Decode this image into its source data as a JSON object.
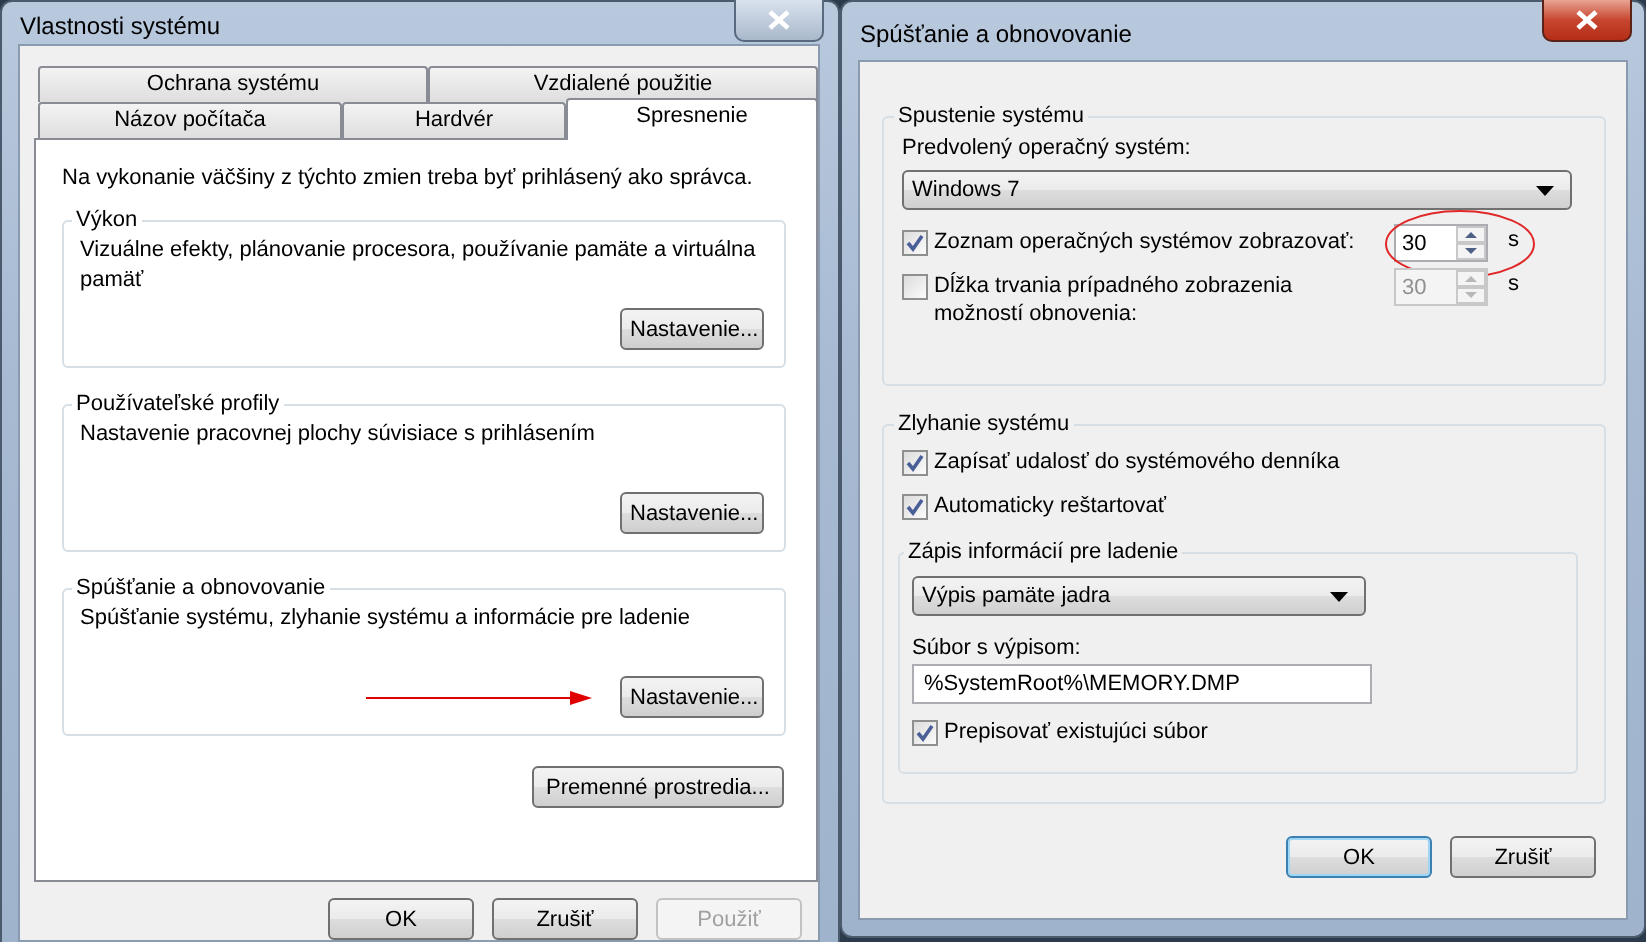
{
  "system_properties": {
    "title": "Vlastnosti systému",
    "tab_rows": [
      [
        {
          "label": "Ochrana systému",
          "selected": false
        },
        {
          "label": "Vzdialené použitie",
          "selected": false
        }
      ],
      [
        {
          "label": "Názov počítača",
          "selected": false
        },
        {
          "label": "Hardvér",
          "selected": false
        },
        {
          "label": "Spresnenie",
          "selected": true
        }
      ]
    ],
    "notice": "Na vykonanie väčšiny z týchto zmien treba byť prihlásený ako správca.",
    "groups": [
      {
        "title": "Výkon",
        "description": "Vizuálne efekty, plánovanie procesora, používanie pamäte a virtuálna pamäť",
        "button": "Nastavenie...",
        "arrow": false
      },
      {
        "title": "Používateľské profily",
        "description": "Nastavenie pracovnej plochy súvisiace s prihlásením",
        "button": "Nastavenie...",
        "arrow": false
      },
      {
        "title": "Spúšťanie a obnovovanie",
        "description": "Spúšťanie systému, zlyhanie systému a informácie pre ladenie",
        "button": "Nastavenie...",
        "arrow": true
      }
    ],
    "env_button": "Premenné prostredia...",
    "buttons": [
      {
        "label": "OK",
        "disabled": false
      },
      {
        "label": "Zrušiť",
        "disabled": false
      },
      {
        "label": "Použiť",
        "disabled": true
      }
    ]
  },
  "startup_recovery": {
    "title": "Spúšťanie a obnovovanie",
    "startup": {
      "title": "Spustenie systému",
      "default_os_label": "Predvolený operačný systém:",
      "default_os": "Windows 7",
      "options": [
        {
          "label": "Zoznam operačných systémov zobrazovať:",
          "checked": true,
          "value": "30",
          "unit": "s",
          "disabled": false,
          "circled": true
        },
        {
          "label": "Dĺžka trvania prípadného zobrazenia možností obnovenia:",
          "checked": false,
          "value": "30",
          "unit": "s",
          "disabled": true,
          "circled": false
        }
      ]
    },
    "failure": {
      "title": "Zlyhanie systému",
      "checks": [
        {
          "label": "Zapísať udalosť do systémového denníka",
          "checked": true
        },
        {
          "label": "Automaticky reštartovať",
          "checked": true
        }
      ],
      "debug": {
        "title": "Zápis informácií pre ladenie",
        "dump_type": "Výpis pamäte jadra",
        "file_label": "Súbor s výpisom:",
        "file": "%SystemRoot%\\MEMORY.DMP",
        "overwrite": {
          "label": "Prepisovať existujúci súbor",
          "checked": true
        }
      }
    },
    "buttons": [
      {
        "label": "OK",
        "default": true
      },
      {
        "label": "Zrušiť",
        "default": false
      }
    ]
  }
}
